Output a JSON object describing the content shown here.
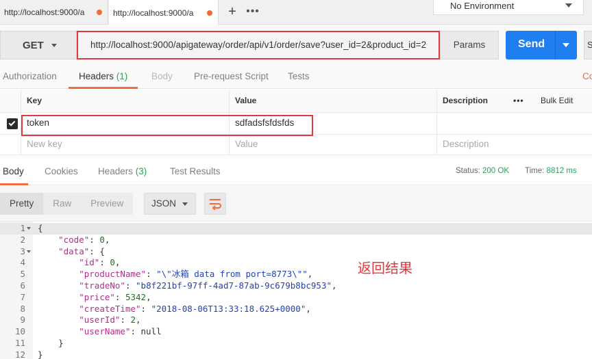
{
  "tabs": [
    {
      "label": "http://localhost:9000/a",
      "unsaved": true
    },
    {
      "label": "http://localhost:9000/a",
      "unsaved": true
    }
  ],
  "new_tab_label": "+",
  "more_tabs_label": "•••",
  "environment": {
    "selected": "No Environment"
  },
  "request": {
    "method": "GET",
    "url": "http://localhost:9000/apigateway/order/api/v1/order/save?user_id=2&product_id=2",
    "params_label": "Params",
    "send_label": "Send",
    "save_stub": "S"
  },
  "request_tabs": {
    "authorization": "Authorization",
    "headers": "Headers",
    "headers_count": "(1)",
    "body": "Body",
    "prerequest": "Pre-request Script",
    "tests": "Tests",
    "cut": "Co"
  },
  "headers_table": {
    "col_key": "Key",
    "col_value": "Value",
    "col_description": "Description",
    "more": "•••",
    "bulk_edit": "Bulk Edit",
    "rows": [
      {
        "key": "token",
        "value": "sdfadsfsfdsfds",
        "description": "",
        "checked": true
      }
    ],
    "new_row": {
      "key": "New key",
      "value": "Value",
      "description": "Description"
    }
  },
  "response_tabs": {
    "body": "Body",
    "cookies": "Cookies",
    "headers": "Headers",
    "headers_count": "(3)",
    "test_results": "Test Results"
  },
  "status": {
    "status_label": "Status:",
    "status_value": "200 OK",
    "time_label": "Time:",
    "time_value": "8812 ms"
  },
  "response_toolbar": {
    "pretty": "Pretty",
    "raw": "Raw",
    "preview": "Preview",
    "format": "JSON"
  },
  "response_lines": [
    {
      "n": "1",
      "fold": true,
      "text": "{"
    },
    {
      "n": "2",
      "fold": false,
      "text": "    \"code\": 0,"
    },
    {
      "n": "3",
      "fold": true,
      "text": "    \"data\": {"
    },
    {
      "n": "4",
      "fold": false,
      "text": "        \"id\": 0,"
    },
    {
      "n": "5",
      "fold": false,
      "text": "        \"productName\": \"\\\"冰箱 data from port=8773\\\"\","
    },
    {
      "n": "6",
      "fold": false,
      "text": "        \"tradeNo\": \"b8f221bf-97ff-4ad7-87ab-9c679b8bc953\","
    },
    {
      "n": "7",
      "fold": false,
      "text": "        \"price\": 5342,"
    },
    {
      "n": "8",
      "fold": false,
      "text": "        \"createTime\": \"2018-08-06T13:33:18.625+0000\","
    },
    {
      "n": "9",
      "fold": false,
      "text": "        \"userId\": 2,"
    },
    {
      "n": "10",
      "fold": false,
      "text": "        \"userName\": null"
    },
    {
      "n": "11",
      "fold": false,
      "text": "    }"
    },
    {
      "n": "12",
      "fold": false,
      "text": "}"
    }
  ],
  "annotation": "返回结果",
  "colors": {
    "accent": "#f26b3a",
    "send": "#1f7ff0",
    "ok": "#27a35a",
    "highlight": "#e0393e"
  }
}
